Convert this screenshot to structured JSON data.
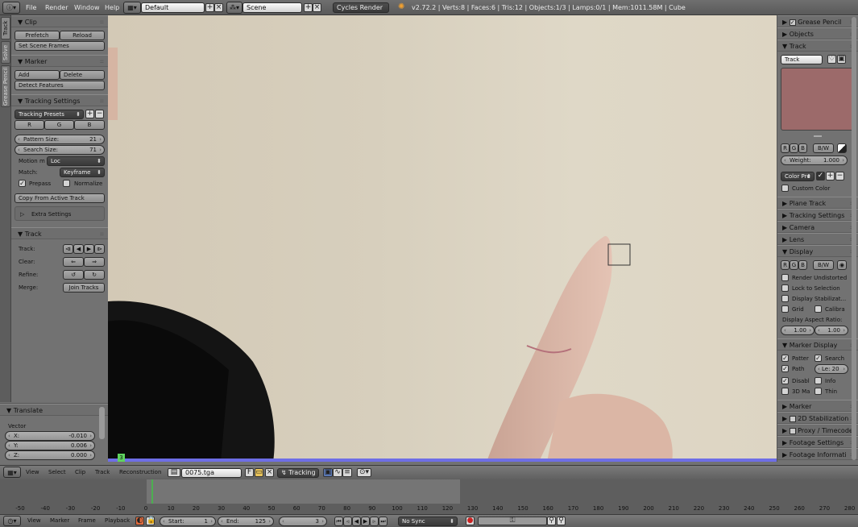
{
  "topbar": {
    "menu": [
      "File",
      "Render",
      "Window",
      "Help"
    ],
    "layout_value": "Default",
    "scene_value": "Scene",
    "engine_value": "Cycles Render",
    "stats": "v2.72.2 | Verts:8 | Faces:6 | Tris:12 | Objects:1/3 | Lamps:0/1 | Mem:1011.58M | Cube"
  },
  "tabs": [
    "Track",
    "Solve",
    "Grease Pencil"
  ],
  "toolshelf": {
    "clip": {
      "title": "Clip",
      "prefetch": "Prefetch",
      "reload": "Reload",
      "set_scene_frames": "Set Scene Frames"
    },
    "marker": {
      "title": "Marker",
      "add": "Add",
      "delete": "Delete",
      "detect": "Detect Features"
    },
    "tracking_settings": {
      "title": "Tracking Settings",
      "presets": "Tracking Presets",
      "r": "R",
      "g": "G",
      "b": "B",
      "pattern_label": "Pattern Size:",
      "pattern_value": "21",
      "search_label": "Search Size:",
      "search_value": "71",
      "motion_label": "Motion m",
      "motion_value": "Loc",
      "match_label": "Match:",
      "match_value": "Keyframe",
      "prepass": "Prepass",
      "normalize": "Normalize",
      "copy_from_active": "Copy From Active Track",
      "extra_settings": "Extra Settings"
    },
    "track": {
      "title": "Track",
      "track_label": "Track:",
      "clear_label": "Clear:",
      "refine_label": "Refine:",
      "merge_label": "Merge:",
      "join_tracks": "Join Tracks"
    }
  },
  "translate": {
    "title": "Translate",
    "vector_label": "Vector",
    "x_label": "X:",
    "x_value": "-0.010",
    "y_label": "Y:",
    "y_value": "0.006",
    "z_label": "Z:",
    "z_value": "0.000"
  },
  "viewport": {
    "frame_badge": "3"
  },
  "properties": {
    "grease_pencil": "Grease Pencil",
    "objects": "Objects",
    "track": {
      "title": "Track",
      "name": "Track",
      "r": "R",
      "g": "G",
      "b": "B",
      "bw": "B/W",
      "weight_label": "Weight:",
      "weight_value": "1.000",
      "color_preset": "Color Pre",
      "custom_color": "Custom Color"
    },
    "plane_track": "Plane Track",
    "tracking_settings": "Tracking Settings",
    "camera": "Camera",
    "lens": "Lens",
    "display": {
      "title": "Display",
      "r": "R",
      "g": "G",
      "b": "B",
      "bw": "B/W",
      "render_undistorted": "Render Undistorted",
      "lock_to_selection": "Lock to Selection",
      "display_stabilization": "Display Stabilizat...",
      "grid": "Grid",
      "calibration": "Calibra",
      "aspect_label": "Display Aspect Ratio:",
      "aspect_x": "1.00",
      "aspect_y": "1.00"
    },
    "marker_display": {
      "title": "Marker Display",
      "pattern": "Patter",
      "search": "Search",
      "path": "Path",
      "length": "Le: 20",
      "disabled": "Disabl",
      "info": "Info",
      "3d_markers": "3D Ma",
      "thin": "Thin"
    },
    "marker": "Marker",
    "stabilization": "2D Stabilization",
    "proxy": "Proxy / Timecode",
    "footage_settings": "Footage Settings",
    "footage_info": "Footage Informati"
  },
  "clipbar": {
    "menu": [
      "View",
      "Select",
      "Clip",
      "Track",
      "Reconstruction"
    ],
    "clip_name": "0075.tga",
    "f_label": "F",
    "mode": "Tracking"
  },
  "timeline": {
    "ruler": [
      "-50",
      "-40",
      "-30",
      "-20",
      "-10",
      "0",
      "10",
      "20",
      "30",
      "40",
      "50",
      "60",
      "70",
      "80",
      "90",
      "100",
      "110",
      "120",
      "130",
      "140",
      "150",
      "160",
      "170",
      "180",
      "190",
      "200",
      "210",
      "220",
      "230",
      "240",
      "250",
      "260",
      "270",
      "280"
    ]
  },
  "timeline_bar": {
    "menu": [
      "View",
      "Marker",
      "Frame",
      "Playback"
    ],
    "start_label": "Start:",
    "start_value": "1",
    "end_label": "End:",
    "end_value": "125",
    "current_frame": "3",
    "sync": "No Sync"
  },
  "colors": {
    "track_color": "#9c6a6a",
    "timeline_cache": "#6e6ee6",
    "frame_marker": "#5fd35f",
    "playhead": "#4caf50"
  }
}
